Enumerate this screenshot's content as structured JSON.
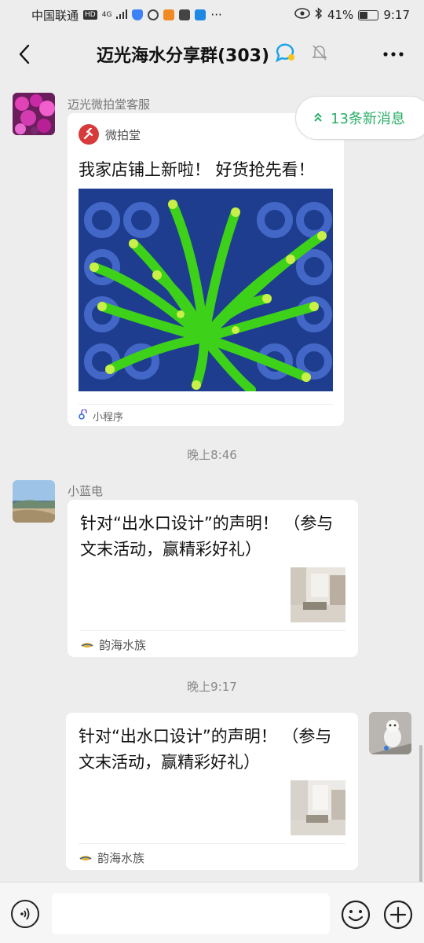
{
  "status_bar": {
    "carrier": "中国联通",
    "network_badge": "HD",
    "signal_label": "4G",
    "battery_pct": "41%",
    "battery_level": 0.41,
    "time": "9:17"
  },
  "header": {
    "title": "迈光海水分享群(303)",
    "icons": [
      "back-icon",
      "chat-bubble-icon",
      "mute-bell-icon",
      "more-icon"
    ]
  },
  "new_messages": {
    "label": "13条新消息"
  },
  "messages": [
    {
      "sender": "迈光微拍堂客服",
      "app_name": "微拍堂",
      "title": "我家店铺上新啦！ 好货抢先看！",
      "footer": "小程序"
    },
    {
      "time": "晚上8:46"
    },
    {
      "sender": "小蓝电",
      "title": "针对“出水口设计”的声明！ （参与文末活动，赢精彩好礼）",
      "footer": "韵海水族"
    },
    {
      "time": "晚上9:17"
    },
    {
      "sender": "",
      "title": "针对“出水口设计”的声明！ （参与文末活动，赢精彩好礼）",
      "footer": "韵海水族"
    }
  ],
  "input": {
    "placeholder": "",
    "value": ""
  },
  "colors": {
    "background": "#ededed",
    "accent_green": "#2aae67",
    "bubble": "#ffffff",
    "weipaitang_red": "#d63a3a"
  }
}
